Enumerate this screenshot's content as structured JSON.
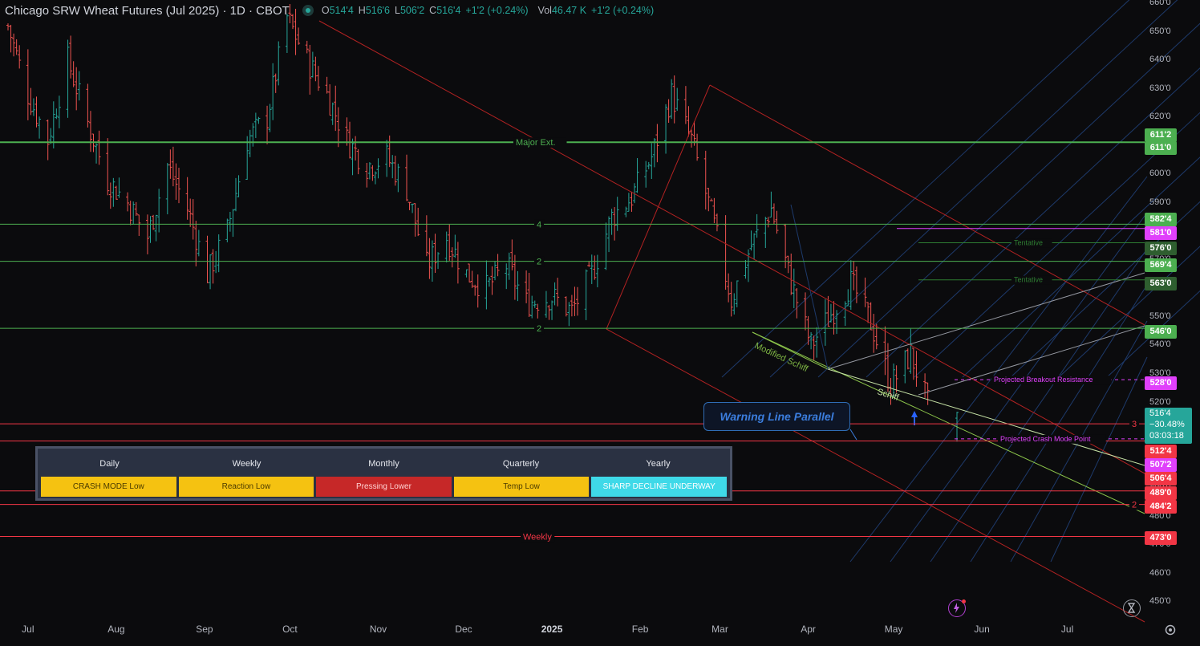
{
  "header": {
    "symbol": "Chicago SRW Wheat Futures (Jul 2025) · 1D · CBOT",
    "o_label": "O",
    "o": "514'4",
    "h_label": "H",
    "h": "516'6",
    "l_label": "L",
    "l": "506'2",
    "c_label": "C",
    "c": "516'4",
    "chg": "+1'2 (+0.24%)",
    "vol_label": "Vol",
    "vol": "46.47 K",
    "vol_chg": "+1'2 (+0.24%)"
  },
  "colors": {
    "up": "#26a69a",
    "down": "#ef5350",
    "green_line": "#4caf50",
    "red_line": "#f23645",
    "magenta": "#e040fb",
    "blue_grid": "#1e3a6b",
    "gold": "#f5c211",
    "crimson": "#c62828",
    "cyan": "#3fd9e8"
  },
  "chart_data": {
    "type": "ohlc",
    "title": "Chicago SRW Wheat Futures (Jul 2025) · 1D · CBOT",
    "y_ticks": [
      "450'0",
      "460'0",
      "470'0",
      "480'0",
      "490'0",
      "500'0",
      "510'0",
      "520'0",
      "530'0",
      "540'0",
      "550'0",
      "560'0",
      "570'0",
      "580'0",
      "590'0",
      "600'0",
      "610'0",
      "620'0",
      "630'0",
      "640'0",
      "650'0",
      "660'0"
    ],
    "ylim": [
      445,
      663
    ],
    "x_ticks": [
      "Jul",
      "Aug",
      "Sep",
      "Oct",
      "Nov",
      "Dec",
      "2025",
      "Feb",
      "Mar",
      "Apr",
      "May",
      "Jun",
      "Jul"
    ],
    "close_path": [
      [
        "2024-06-24",
        652
      ],
      [
        "2024-07-01",
        628
      ],
      [
        "2024-07-08",
        612
      ],
      [
        "2024-07-15",
        640
      ],
      [
        "2024-07-22",
        618
      ],
      [
        "2024-07-29",
        598
      ],
      [
        "2024-08-05",
        590
      ],
      [
        "2024-08-12",
        578
      ],
      [
        "2024-08-19",
        603
      ],
      [
        "2024-08-26",
        588
      ],
      [
        "2024-09-02",
        565
      ],
      [
        "2024-09-09",
        580
      ],
      [
        "2024-09-16",
        612
      ],
      [
        "2024-09-23",
        620
      ],
      [
        "2024-09-30",
        655
      ],
      [
        "2024-10-07",
        640
      ],
      [
        "2024-10-14",
        628
      ],
      [
        "2024-10-21",
        612
      ],
      [
        "2024-10-28",
        603
      ],
      [
        "2024-11-04",
        606
      ],
      [
        "2024-11-11",
        595
      ],
      [
        "2024-11-18",
        568
      ],
      [
        "2024-11-25",
        578
      ],
      [
        "2024-12-02",
        565
      ],
      [
        "2024-12-09",
        560
      ],
      [
        "2024-12-16",
        568
      ],
      [
        "2024-12-23",
        555
      ],
      [
        "2025-01-01",
        557
      ],
      [
        "2025-01-08",
        552
      ],
      [
        "2025-01-15",
        565
      ],
      [
        "2025-01-22",
        585
      ],
      [
        "2025-01-29",
        592
      ],
      [
        "2025-02-05",
        606
      ],
      [
        "2025-02-12",
        628
      ],
      [
        "2025-02-19",
        612
      ],
      [
        "2025-02-26",
        586
      ],
      [
        "2025-03-05",
        556
      ],
      [
        "2025-03-12",
        575
      ],
      [
        "2025-03-19",
        588
      ],
      [
        "2025-03-26",
        562
      ],
      [
        "2025-04-02",
        540
      ],
      [
        "2025-04-09",
        551
      ],
      [
        "2025-04-16",
        562
      ],
      [
        "2025-04-23",
        548
      ],
      [
        "2025-04-30",
        526
      ],
      [
        "2025-05-07",
        537
      ],
      [
        "2025-05-14",
        516.5
      ]
    ],
    "horizontal_levels": [
      {
        "value": 611.25,
        "label": "Major Ext.",
        "color": "green"
      },
      {
        "value": 582.5,
        "label": "4",
        "color": "green"
      },
      {
        "value": 569.5,
        "label": "2",
        "color": "green"
      },
      {
        "value": 546,
        "label": "2",
        "color": "green"
      },
      {
        "value": 512.5,
        "label": "3",
        "color": "red"
      },
      {
        "value": 506.5,
        "label": "",
        "color": "red"
      },
      {
        "value": 489,
        "label": "",
        "color": "red"
      },
      {
        "value": 484.25,
        "label": "2",
        "color": "red"
      },
      {
        "value": 473,
        "label": "Weekly",
        "color": "red"
      }
    ],
    "annotations": [
      "Modified Schiff",
      "Schiff",
      "Tentative",
      "Tentative",
      "Projected Breakout Resistance",
      "Projected Crash Mode Point",
      "Warning Line Parallel"
    ]
  },
  "price_tags": [
    {
      "text": "611'2",
      "bg": "#4caf50"
    },
    {
      "text": "611'0",
      "bg": "#4caf50"
    },
    {
      "text": "582'4",
      "bg": "#4caf50"
    },
    {
      "text": "581'0",
      "bg": "#e040fb"
    },
    {
      "text": "576'0",
      "bg": "#2e5e2f"
    },
    {
      "text": "569'4",
      "bg": "#4caf50"
    },
    {
      "text": "563'0",
      "bg": "#2e5e2f"
    },
    {
      "text": "546'0",
      "bg": "#4caf50"
    },
    {
      "text": "528'0",
      "bg": "#e040fb"
    },
    {
      "text": "512'4",
      "bg": "#f23645"
    },
    {
      "text": "507'2",
      "bg": "#e040fb"
    },
    {
      "text": "506'4",
      "bg": "#f23645"
    },
    {
      "text": "489'0",
      "bg": "#f23645"
    },
    {
      "text": "484'2",
      "bg": "#f23645"
    },
    {
      "text": "473'0",
      "bg": "#f23645"
    }
  ],
  "last_price": {
    "price": "516'4",
    "pct": "−30.48%",
    "timer": "03:03:18"
  },
  "labels": {
    "major_ext": "Major Ext.",
    "four": "4",
    "two_a": "2",
    "two_b": "2",
    "three": "3",
    "two_c": "2",
    "weekly": "Weekly",
    "modified_schiff": "Modified Schiff",
    "schiff": "Schiff",
    "tentative1": "Tentative",
    "tentative2": "Tentative",
    "breakout": "Projected Breakout Resistance",
    "crash": "Projected Crash Mode Point",
    "warning": "Warning Line Parallel"
  },
  "status_table": {
    "headers": [
      "Daily",
      "Weekly",
      "Monthly",
      "Quarterly",
      "Yearly"
    ],
    "cells": [
      {
        "text": "CRASH MODE Low",
        "bg": "#f5c211",
        "fg": "#4a3a00"
      },
      {
        "text": "Reaction Low",
        "bg": "#f5c211",
        "fg": "#4a3a00"
      },
      {
        "text": "Pressing Lower",
        "bg": "#c62828",
        "fg": "#ffd0d0"
      },
      {
        "text": "Temp Low",
        "bg": "#f5c211",
        "fg": "#4a3a00"
      },
      {
        "text": "SHARP DECLINE UNDERWAY",
        "bg": "#3fd9e8",
        "fg": "#ffffff"
      }
    ]
  },
  "icons": {
    "flash": "lightning-icon",
    "replay": "hourglass-icon",
    "settings": "gear-icon"
  }
}
